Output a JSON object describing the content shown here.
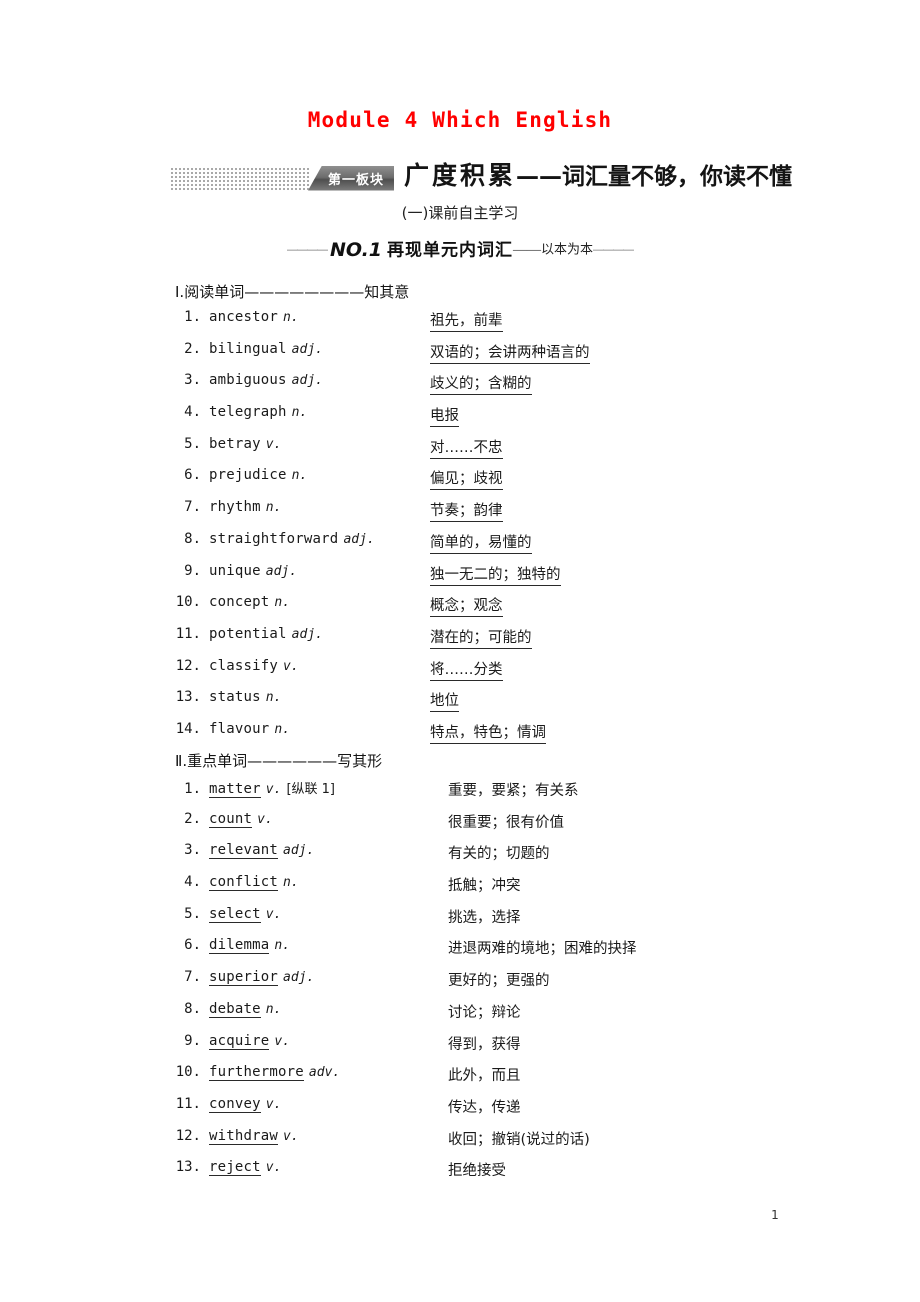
{
  "module_title": "Module 4 Which English",
  "banner": {
    "badge_label": "第一板块",
    "heading_lead": "广度积累",
    "heading_tail": "——词汇量不够，你读不懂"
  },
  "subheading": "(一)课前自主学习",
  "no_line": {
    "dash_left": "————",
    "number": "NO.1",
    "title": "再现单元内词汇",
    "mdash": "——",
    "sub": "以本为本",
    "dash_right": "————"
  },
  "sections": [
    {
      "title": "Ⅰ.阅读单词————————知其意",
      "answer_style": "meaning-underlined",
      "items": [
        {
          "num": "1.",
          "word": "ancestor",
          "pos": "n.",
          "tag": "",
          "meaning": "祖先，前辈"
        },
        {
          "num": "2.",
          "word": "bilingual",
          "pos": "adj.",
          "tag": "",
          "meaning": "双语的；会讲两种语言的 "
        },
        {
          "num": "3.",
          "word": "ambiguous",
          "pos": "adj.",
          "tag": "",
          "meaning": "歧义的；含糊的"
        },
        {
          "num": "4.",
          "word": "telegraph",
          "pos": "n.",
          "tag": "",
          "meaning": "电报"
        },
        {
          "num": "5.",
          "word": "betray",
          "pos": "v.",
          "tag": "",
          "meaning": "对……不忠"
        },
        {
          "num": "6.",
          "word": "prejudice",
          "pos": "n.",
          "tag": "",
          "meaning": "偏见；歧视"
        },
        {
          "num": "7.",
          "word": "rhythm",
          "pos": "n.",
          "tag": "",
          "meaning": "节奏；韵律"
        },
        {
          "num": "8.",
          "word": "straightforward",
          "pos": "adj.",
          "tag": "",
          "meaning": "简单的，易懂的"
        },
        {
          "num": "9.",
          "word": "unique",
          "pos": "adj.",
          "tag": "",
          "meaning": "独一无二的；独特的"
        },
        {
          "num": "10.",
          "word": "concept",
          "pos": "n.",
          "tag": "",
          "meaning": "概念；观念"
        },
        {
          "num": "11.",
          "word": "potential",
          "pos": "adj.",
          "tag": "",
          "meaning": "潜在的；可能的"
        },
        {
          "num": "12.",
          "word": "classify",
          "pos": "v.",
          "tag": "",
          "meaning": "将……分类"
        },
        {
          "num": "13.",
          "word": "status",
          "pos": "n.",
          "tag": "",
          "meaning": "地位 "
        },
        {
          "num": "14.",
          "word": "flavour",
          "pos": "n.",
          "tag": "",
          "meaning": "特点，特色；情调"
        }
      ]
    },
    {
      "title": "Ⅱ.重点单词——————写其形",
      "answer_style": "word-underlined",
      "items": [
        {
          "num": "1.",
          "word": "matter",
          "pos": "v.",
          "tag": "[纵联 1]",
          "meaning": "重要，要紧；有关系"
        },
        {
          "num": "2.",
          "word": "count",
          "pos": "v.",
          "tag": "",
          "meaning": "很重要；很有价值"
        },
        {
          "num": "3.",
          "word": "relevant",
          "pos": "adj.",
          "tag": "",
          "meaning": "有关的；切题的"
        },
        {
          "num": "4.",
          "word": "conflict",
          "pos": "n.",
          "tag": "",
          "meaning": "抵触；冲突"
        },
        {
          "num": "5.",
          "word": "select",
          "pos": "v.",
          "tag": "",
          "meaning": "挑选，选择"
        },
        {
          "num": "6.",
          "word": "dilemma",
          "pos": "n.",
          "tag": "",
          "meaning": "进退两难的境地；困难的抉择"
        },
        {
          "num": "7.",
          "word": "superior",
          "pos": "adj.",
          "tag": "",
          "meaning": "更好的；更强的"
        },
        {
          "num": "8.",
          "word": "debate",
          "pos": "n.",
          "tag": "",
          "meaning": "讨论；辩论"
        },
        {
          "num": "9.",
          "word": "acquire",
          "pos": "v.",
          "tag": "",
          "meaning": "得到，获得"
        },
        {
          "num": "10.",
          "word": "furthermore",
          "pos": "adv.",
          "tag": "",
          "meaning": "此外，而且"
        },
        {
          "num": "11.",
          "word": "convey",
          "pos": "v.",
          "tag": "",
          "meaning": "传达，传递"
        },
        {
          "num": "12.",
          "word": "withdraw",
          "pos": "v.",
          "tag": "",
          "meaning": "收回；撤销(说过的话)"
        },
        {
          "num": "13.",
          "word": "reject",
          "pos": "v.",
          "tag": "",
          "meaning": "拒绝接受"
        }
      ]
    }
  ],
  "page_number": "1",
  "colors": {
    "module_title": "#ff0000",
    "text": "#1a1a1a",
    "badge_gray": "#6d6d6d"
  }
}
